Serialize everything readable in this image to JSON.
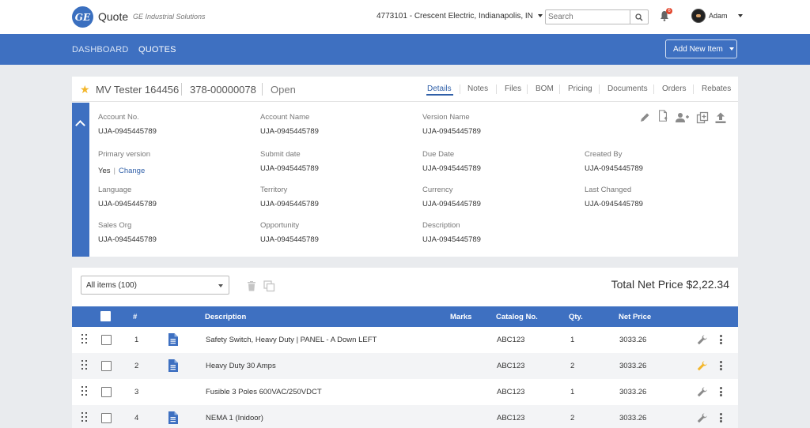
{
  "header": {
    "logo_text": "GE",
    "app_title": "Quote",
    "app_subtitle": "GE Industrial Solutions",
    "account": "4773101 - Crescent Electric, Indianapolis, IN",
    "search_placeholder": "Search",
    "notification_count": "6",
    "user_name": "Adam"
  },
  "nav": {
    "items": [
      {
        "label": "DASHBOARD",
        "active": false
      },
      {
        "label": "QUOTES",
        "active": true
      }
    ],
    "add_button": "Add New Item"
  },
  "quote": {
    "name": "MV Tester 164456",
    "number": "378-00000078",
    "status": "Open",
    "tabs": [
      "Details",
      "Notes",
      "Files",
      "BOM",
      "Pricing",
      "Documents",
      "Orders",
      "Rebates"
    ],
    "active_tab": "Details",
    "fields": {
      "account_no": {
        "label": "Account No.",
        "value": "UJA-0945445789"
      },
      "account_name": {
        "label": "Account Name",
        "value": "UJA-0945445789"
      },
      "version_name": {
        "label": "Version Name",
        "value": "UJA-0945445789"
      },
      "primary_version": {
        "label": "Primary version",
        "value": "Yes",
        "link": "Change"
      },
      "submit_date": {
        "label": "Submit date",
        "value": "UJA-0945445789"
      },
      "due_date": {
        "label": "Due Date",
        "value": "UJA-0945445789"
      },
      "created_by": {
        "label": "Created By",
        "value": "UJA-0945445789"
      },
      "language": {
        "label": "Language",
        "value": "UJA-0945445789"
      },
      "territory": {
        "label": "Territory",
        "value": "UJA-0945445789"
      },
      "currency": {
        "label": "Currency",
        "value": "UJA-0945445789"
      },
      "last_changed": {
        "label": "Last Changed",
        "value": "UJA-0945445789"
      },
      "sales_org": {
        "label": "Sales Org",
        "value": "UJA-0945445789"
      },
      "opportunity": {
        "label": "Opportunity",
        "value": "UJA-0945445789"
      },
      "description": {
        "label": "Description",
        "value": "UJA-0945445789"
      }
    },
    "actions": [
      "pencil-icon",
      "new-document-icon",
      "add-user-icon",
      "duplicate-icon",
      "upload-icon"
    ]
  },
  "items": {
    "filter_value": "All items (100)",
    "total_net_price": "Total Net Price $2,22.34",
    "columns": {
      "num": "#",
      "description": "Description",
      "marks": "Marks",
      "catalog": "Catalog No.",
      "qty": "Qty.",
      "net_price": "Net Price"
    },
    "rows": [
      {
        "num": "1",
        "has_doc": true,
        "description": "Safety Switch, Heavy Duty | PANEL - A Down LEFT",
        "marks": "",
        "catalog": "ABC123",
        "qty": "1",
        "net_price": "3033.26",
        "wrench_color": "#8a8a8a"
      },
      {
        "num": "2",
        "has_doc": true,
        "description": "Heavy Duty 30 Amps",
        "marks": "",
        "catalog": "ABC123",
        "qty": "2",
        "net_price": "3033.26",
        "wrench_color": "#f3b62a"
      },
      {
        "num": "3",
        "has_doc": false,
        "description": "Fusible 3 Poles 600VAC/250VDCT",
        "marks": "",
        "catalog": "ABC123",
        "qty": "1",
        "net_price": "3033.26",
        "wrench_color": "#8a8a8a"
      },
      {
        "num": "4",
        "has_doc": true,
        "description": "NEMA 1 (Inidoor)",
        "marks": "",
        "catalog": "ABC123",
        "qty": "2",
        "net_price": "3033.26",
        "wrench_color": "#8a8a8a"
      }
    ]
  },
  "colors": {
    "brand_blue": "#3e70c1",
    "link_blue": "#2f5fa8",
    "star": "#f3b62a",
    "badge_red": "#e2452c"
  }
}
